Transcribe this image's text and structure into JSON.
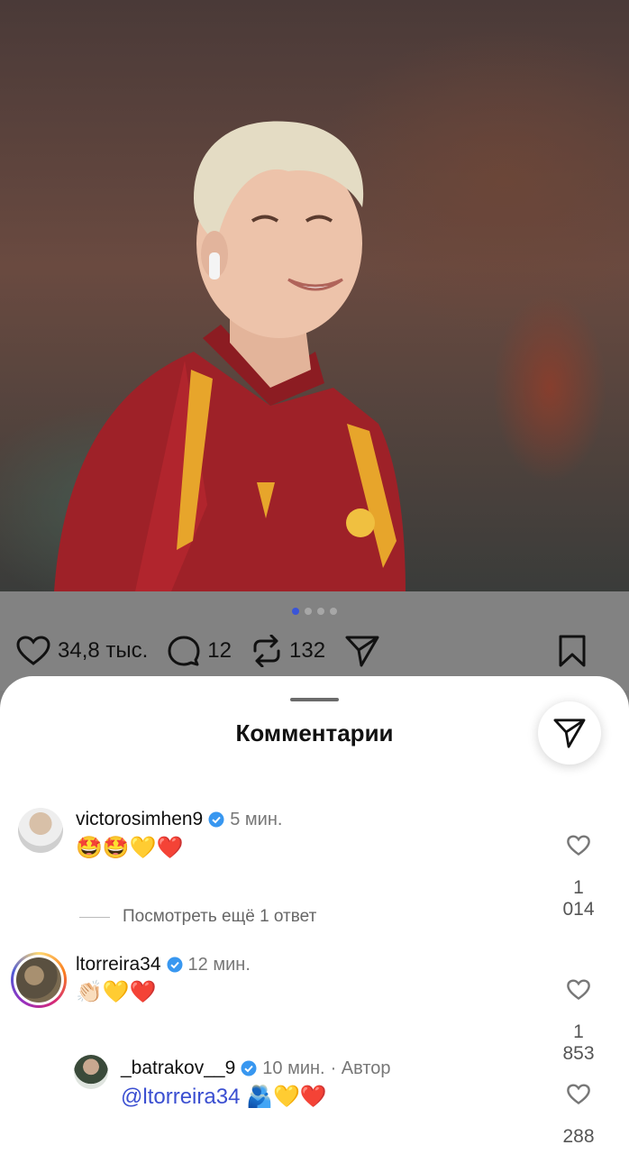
{
  "post": {
    "pagination": {
      "total": 4,
      "active": 0
    },
    "likes": "34,8 тыс.",
    "comments": "12",
    "reposts": "132"
  },
  "sheet": {
    "title": "Комментарии"
  },
  "comments": [
    {
      "username": "victorosimhen9",
      "time": "5 мин.",
      "text": "🤩🤩💛❤️",
      "likes": "1 014",
      "view_more": "Посмотреть ещё 1 ответ"
    },
    {
      "username": "ltorreira34",
      "time": "12 мин.",
      "text": "👏🏻💛❤️",
      "likes": "1 853"
    }
  ],
  "reply": {
    "username": "_batrakov__9",
    "time": "10 мин.",
    "author_label": "· Автор",
    "mention": "@ltorreira34",
    "text": "🫂💛❤️",
    "likes": "288"
  },
  "colors": {
    "accent": "#3b4fd1",
    "verified": "#3897f0",
    "story_ring": "#d6249f"
  }
}
